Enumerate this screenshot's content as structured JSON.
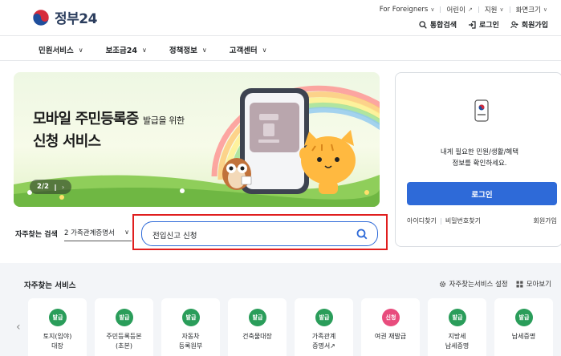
{
  "header": {
    "logo_text": "정부24",
    "util": [
      {
        "label": "For Foreigners",
        "suffix": "∨"
      },
      {
        "label": "어린이",
        "suffix": "↗"
      },
      {
        "label": "지원",
        "suffix": "∨"
      },
      {
        "label": "화면크기",
        "suffix": "∨"
      }
    ],
    "actions": [
      {
        "label": "통합검색",
        "icon": "search-icon"
      },
      {
        "label": "로그인",
        "icon": "login-icon"
      },
      {
        "label": "회원가입",
        "icon": "user-add-icon"
      }
    ]
  },
  "gnb": {
    "items": [
      "민원서비스",
      "보조금24",
      "정책정보",
      "고객센터"
    ]
  },
  "banner": {
    "title_main": "모바일 주민등록증",
    "title_small": "발급을 위한",
    "subtitle": "신청 서비스",
    "pager_text": "2/2",
    "pause_icon": "‖",
    "next_icon": "›"
  },
  "login_box": {
    "message_line1": "내게 필요한 민원/생활/혜택",
    "message_line2": "정보를 확인하세요.",
    "login_button": "로그인",
    "find_id": "아이디찾기",
    "find_password": "비밀번호찾기",
    "signup": "회원가입"
  },
  "search": {
    "faq_label": "자주찾는 검색",
    "faq_selected": "2 가족관계증명서",
    "query": "전입신고 신청"
  },
  "services": {
    "title": "자주찾는 서비스",
    "settings_label": "자주찾는서비스 설정",
    "view_all_label": "모아보기",
    "cards": [
      {
        "badge": "발급",
        "color": "#2a9d5a",
        "line1": "토지(임야)",
        "line2": "대장"
      },
      {
        "badge": "발급",
        "color": "#2a9d5a",
        "line1": "주민등록등본",
        "line2": "(초본)"
      },
      {
        "badge": "발급",
        "color": "#2a9d5a",
        "line1": "자동차",
        "line2": "등록원부"
      },
      {
        "badge": "발급",
        "color": "#2a9d5a",
        "line1": "건축물대장",
        "line2": ""
      },
      {
        "badge": "발급",
        "color": "#2a9d5a",
        "line1": "가족관계",
        "line2": "증명서↗"
      },
      {
        "badge": "신청",
        "color": "#e84c7d",
        "line1": "여권 재발급",
        "line2": ""
      },
      {
        "badge": "발급",
        "color": "#2a9d5a",
        "line1": "지방세",
        "line2": "납세증명"
      },
      {
        "badge": "발급",
        "color": "#2a9d5a",
        "line1": "납세증명",
        "line2": ""
      }
    ]
  }
}
